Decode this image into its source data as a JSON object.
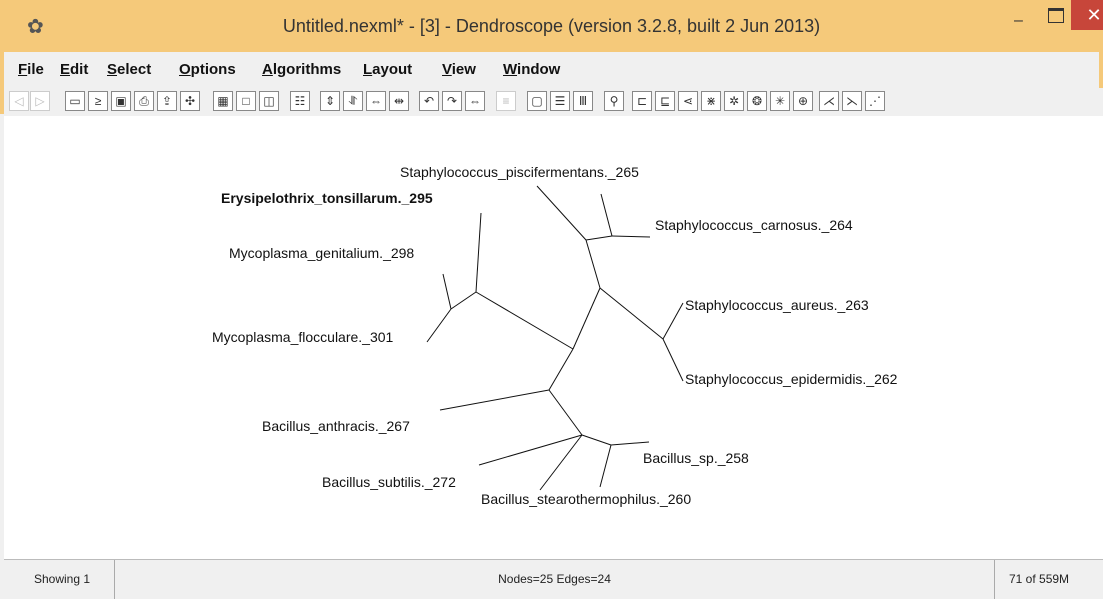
{
  "window": {
    "title": "Untitled.nexml* - [3] - Dendroscope (version 3.2.8, built 2 Jun 2013)",
    "minimize_glyph": "–",
    "close_glyph": "✕"
  },
  "menu": [
    "File",
    "Edit",
    "Select",
    "Options",
    "Algorithms",
    "Layout",
    "View",
    "Window"
  ],
  "toolbar": [
    {
      "icon": "back-icon",
      "glyph": "◁"
    },
    {
      "icon": "forward-icon",
      "glyph": "▷"
    },
    {
      "icon": "open-icon",
      "glyph": "▭"
    },
    {
      "icon": "console-icon",
      "glyph": "≥"
    },
    {
      "icon": "save-icon",
      "glyph": "▣"
    },
    {
      "icon": "print-icon",
      "glyph": "⎙"
    },
    {
      "icon": "export-icon",
      "glyph": "⇪"
    },
    {
      "icon": "find-icon",
      "glyph": "✣"
    },
    {
      "icon": "grid-icon",
      "glyph": "▦"
    },
    {
      "icon": "frame-icon",
      "glyph": "□"
    },
    {
      "icon": "window-icon",
      "glyph": "◫"
    },
    {
      "icon": "list-icon",
      "glyph": "☷"
    },
    {
      "icon": "expand-vertical-icon",
      "glyph": "⇕"
    },
    {
      "icon": "contract-vertical-icon",
      "glyph": "⥯"
    },
    {
      "icon": "expand-horizontal-icon",
      "glyph": "⇔"
    },
    {
      "icon": "contract-horizontal-icon",
      "glyph": "⇹"
    },
    {
      "icon": "rotate-left-icon",
      "glyph": "↶"
    },
    {
      "icon": "rotate-right-icon",
      "glyph": "↷"
    },
    {
      "icon": "flip-icon",
      "glyph": "⇔"
    },
    {
      "icon": "dim-icon",
      "glyph": "≡"
    },
    {
      "icon": "layout-box-icon",
      "glyph": "▢"
    },
    {
      "icon": "layout-rows-icon",
      "glyph": "☰"
    },
    {
      "icon": "layout-cols-icon",
      "glyph": "Ⅲ"
    },
    {
      "icon": "zoom-icon",
      "glyph": "⚲"
    },
    {
      "icon": "rect-phylogram-icon",
      "glyph": "⊏"
    },
    {
      "icon": "rect-cladogram-icon",
      "glyph": "⊑"
    },
    {
      "icon": "slanted-icon",
      "glyph": "⋖"
    },
    {
      "icon": "radial-phylogram-icon",
      "glyph": "⋇"
    },
    {
      "icon": "circular-phylogram-icon",
      "glyph": "✲"
    },
    {
      "icon": "circular-cladogram-icon",
      "glyph": "❂"
    },
    {
      "icon": "radial-cladogram-icon",
      "glyph": "✳"
    },
    {
      "icon": "unrooted-icon",
      "glyph": "⊕"
    },
    {
      "icon": "inner-curve-icon",
      "glyph": "⋌"
    },
    {
      "icon": "outer-curve-icon",
      "glyph": "⋋"
    },
    {
      "icon": "more-icon",
      "glyph": "⋰"
    }
  ],
  "tree": {
    "labels": [
      {
        "id": "piscifermentans",
        "text": "Staphylococcus_piscifermentans._265",
        "bold": false
      },
      {
        "id": "tonsillarum",
        "text": "Erysipelothrix_tonsillarum._295",
        "bold": true
      },
      {
        "id": "carnosus",
        "text": "Staphylococcus_carnosus._264",
        "bold": false
      },
      {
        "id": "genitalium",
        "text": "Mycoplasma_genitalium._298",
        "bold": false
      },
      {
        "id": "aureus",
        "text": "Staphylococcus_aureus._263",
        "bold": false
      },
      {
        "id": "flocculare",
        "text": "Mycoplasma_flocculare._301",
        "bold": false
      },
      {
        "id": "epidermidis",
        "text": "Staphylococcus_epidermidis._262",
        "bold": false
      },
      {
        "id": "anthracis",
        "text": "Bacillus_anthracis._267",
        "bold": false
      },
      {
        "id": "sp",
        "text": "Bacillus_sp._258",
        "bold": false
      },
      {
        "id": "subtilis",
        "text": "Bacillus_subtilis._272",
        "bold": false
      },
      {
        "id": "stearothermophilus",
        "text": "Bacillus_stearothermophilus._260",
        "bold": false
      }
    ]
  },
  "status": {
    "left": "Showing 1",
    "middle": "Nodes=25 Edges=24",
    "right": "71 of 559M"
  }
}
